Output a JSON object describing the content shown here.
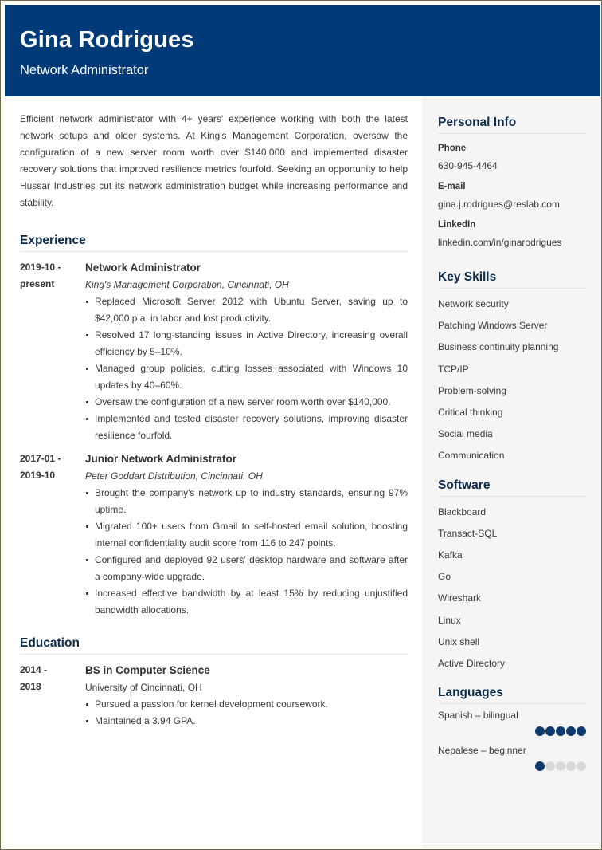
{
  "header": {
    "name": "Gina Rodrigues",
    "title": "Network Administrator"
  },
  "summary": "Efficient network administrator with 4+ years' experience working with both the latest network setups and older systems. At King's Management Corporation, oversaw the configuration of a new server room worth over $140,000 and implemented disaster recovery solutions that improved resilience metrics fourfold. Seeking an opportunity to help Hussar Industries cut its network administration budget while increasing performance and stability.",
  "experience": {
    "heading": "Experience",
    "entries": [
      {
        "date_start": "2019-10 -",
        "date_end": "present",
        "role": "Network Administrator",
        "company": "King's Management Corporation, Cincinnati, OH",
        "bullets": [
          "Replaced Microsoft Server 2012 with Ubuntu Server, saving up to $42,000 p.a. in labor and lost productivity.",
          "Resolved 17 long-standing issues in Active Directory, increasing overall efficiency by 5–10%.",
          "Managed group policies, cutting losses associated with Windows 10 updates by 40–60%.",
          "Oversaw the configuration of a new server room worth over $140,000.",
          "Implemented and tested disaster recovery solutions, improving disaster resilience fourfold."
        ]
      },
      {
        "date_start": "2017-01 -",
        "date_end": "2019-10",
        "role": "Junior Network Administrator",
        "company": "Peter Goddart Distribution, Cincinnati, OH",
        "bullets": [
          "Brought the company's network up to industry standards, ensuring 97% uptime.",
          "Migrated 100+ users from Gmail to self-hosted email solution, boosting internal confidentiality audit score from 116 to 247 points.",
          "Configured and deployed 92 users' desktop hardware and software after a company-wide upgrade.",
          "Increased effective bandwidth by at least 15% by reducing unjustified bandwidth allocations."
        ]
      }
    ]
  },
  "education": {
    "heading": "Education",
    "entries": [
      {
        "date_start": "2014 -",
        "date_end": "2018",
        "degree": "BS in Computer Science",
        "school": "University of Cincinnati, OH",
        "bullets": [
          "Pursued a passion for kernel development coursework.",
          "Maintained a 3.94 GPA."
        ]
      }
    ]
  },
  "sidebar": {
    "personal_info": {
      "heading": "Personal Info",
      "phone_label": "Phone",
      "phone": "630-945-4464",
      "email_label": "E-mail",
      "email": "gina.j.rodrigues@reslab.com",
      "linkedin_label": "LinkedIn",
      "linkedin": "linkedin.com/in/ginarodrigues"
    },
    "key_skills": {
      "heading": "Key Skills",
      "items": [
        "Network security",
        "Patching Windows Server",
        "Business continuity planning",
        "TCP/IP",
        "Problem-solving",
        "Critical thinking",
        "Social media",
        "Communication"
      ]
    },
    "software": {
      "heading": "Software",
      "items": [
        "Blackboard",
        "Transact-SQL",
        "Kafka",
        "Go",
        "Wireshark",
        "Linux",
        "Unix shell",
        "Active Directory"
      ]
    },
    "languages": {
      "heading": "Languages",
      "items": [
        {
          "name": "Spanish – bilingual",
          "level": 5,
          "max": 5
        },
        {
          "name": "Nepalese – beginner",
          "level": 1,
          "max": 5
        }
      ]
    }
  },
  "colors": {
    "header_bg": "#003a78",
    "heading_text": "#0d2b4a",
    "dot_on": "#0d3a6e",
    "dot_off": "#d9d9d9",
    "sidebar_bg": "#f5f5f5"
  }
}
